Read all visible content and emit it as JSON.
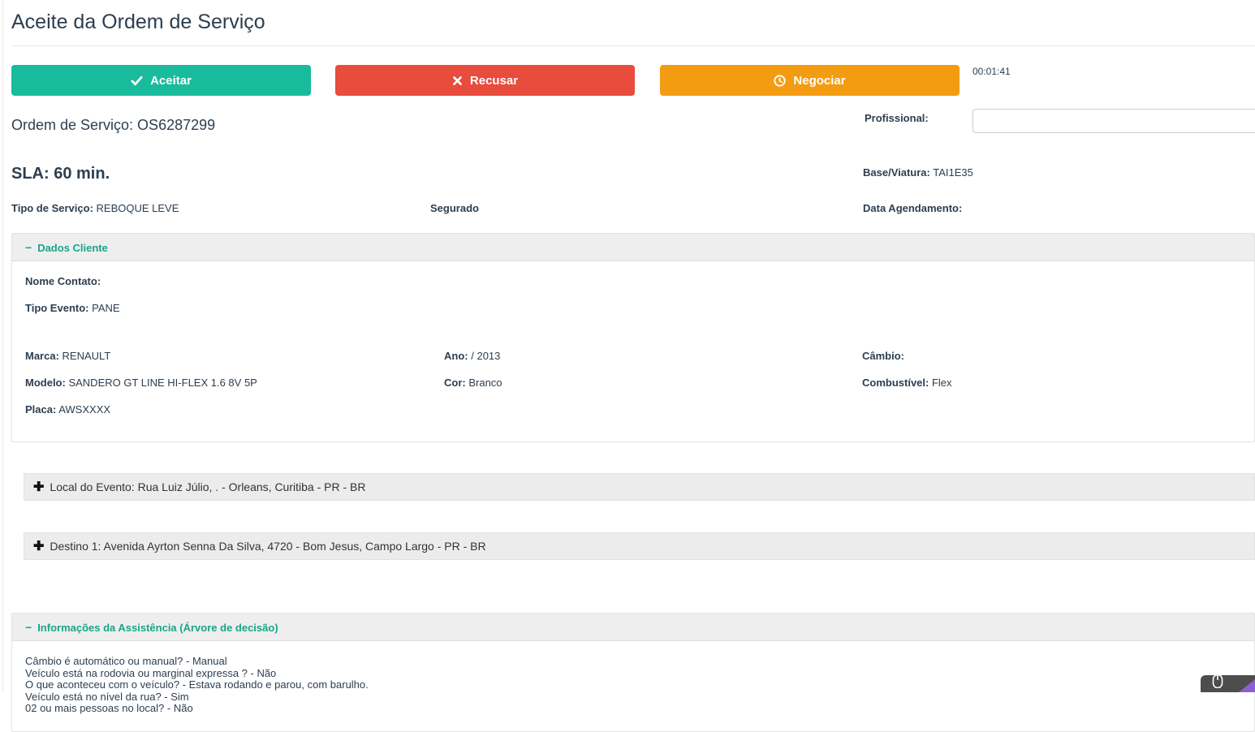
{
  "page": {
    "title": "Aceite da Ordem de Serviço"
  },
  "colors": {
    "accept_green": "#18bc9c",
    "refuse_red": "#e74c3c",
    "negotiate_orange": "#f39c12",
    "panel_title_teal": "#18a689",
    "text_dark": "#2c3e50"
  },
  "actions": {
    "accept_label": "Aceitar",
    "refuse_label": "Recusar",
    "negotiate_label": "Negociar",
    "timer": "00:01:41"
  },
  "order": {
    "os_line": "Ordem de Serviço: OS6287299",
    "professional_label": "Profissional:",
    "professional_value": "",
    "sla_text": "SLA: 60 min.",
    "base_viatura_label": "Base/Viatura:",
    "base_viatura_value": "TAI1E35",
    "tipo_servico_label": "Tipo de Serviço:",
    "tipo_servico_value": "REBOQUE LEVE",
    "segurado_label": "Segurado",
    "data_agendamento_label": "Data Agendamento:",
    "data_agendamento_value": ""
  },
  "client_panel": {
    "title": "Dados Cliente",
    "nome_contato_label": "Nome Contato:",
    "nome_contato_value": "",
    "tipo_evento_label": "Tipo Evento:",
    "tipo_evento_value": "PANE",
    "vehicle": {
      "marca_label": "Marca:",
      "marca": "RENAULT",
      "modelo_label": "Modelo:",
      "modelo": "SANDERO GT LINE HI-FLEX 1.6 8V 5P",
      "placa_label": "Placa:",
      "placa": "AWSXXXX",
      "ano_label": "Ano:",
      "ano": "/ 2013",
      "cor_label": "Cor:",
      "cor": "Branco",
      "cambio_label": "Câmbio:",
      "cambio": "",
      "combustivel_label": "Combustível:",
      "combustivel": "Flex"
    }
  },
  "locations": {
    "local_evento": "Local do Evento: Rua Luiz Júlio, . - Orleans, Curitiba - PR - BR",
    "destino1": "Destino 1: Avenida Ayrton Senna Da Silva, 4720 - Bom Jesus, Campo Largo - PR - BR"
  },
  "assistance": {
    "title": "Informações da Assistência (Árvore de decisão)",
    "lines": [
      "Câmbio é automático ou manual? - Manual",
      "Veículo está na rodovia ou marginal expressa ? - Não",
      "O que aconteceu com o veículo? - Estava rodando e parou, com barulho.",
      "Veículo está no nível da rua? - Sim",
      "02 ou mais pessoas no local? - Não"
    ]
  },
  "icons": {
    "check": "check-icon",
    "cross": "x-icon",
    "clock": "clock-icon",
    "minus": "collapse-minus-icon",
    "plus": "expand-plus-icon",
    "mouse": "mouse-icon",
    "purple_arrow": "purple-arrow-icon"
  }
}
